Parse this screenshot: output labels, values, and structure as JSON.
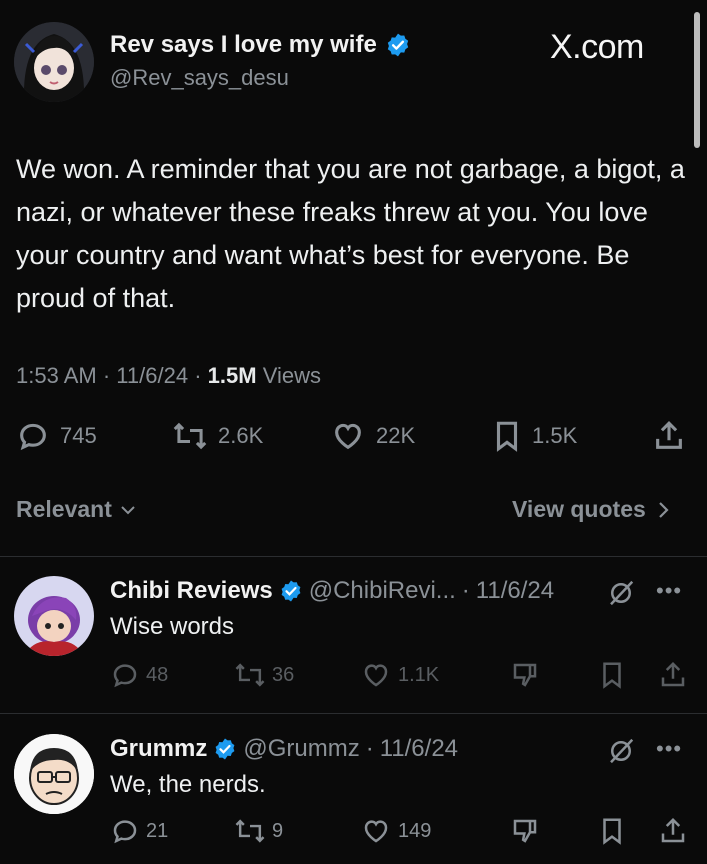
{
  "main_tweet": {
    "author_name": "Rev says I love my wife",
    "handle": "@Rev_says_desu",
    "site": "X.com",
    "text": "We won. A reminder that you are not garbage, a bigot, a nazi, or whatever these freaks threw at you. You love your country and want what’s best for everyone. Be proud of that.",
    "time": "1:53 AM",
    "date": "11/6/24",
    "views_count": "1.5M",
    "views_label": "Views",
    "sep": "·",
    "replies": "745",
    "reposts": "2.6K",
    "likes": "22K",
    "bookmarks": "1.5K"
  },
  "sort": {
    "label": "Relevant",
    "view_quotes": "View quotes"
  },
  "replies": [
    {
      "name": "Chibi Reviews",
      "handle": "@ChibiRevi...",
      "date": "11/6/24",
      "text": "Wise words",
      "replies": "48",
      "reposts": "36",
      "likes": "1.1K"
    },
    {
      "name": "Grummz",
      "handle": "@Grummz",
      "date": "11/6/24",
      "text": "We, the nerds.",
      "replies": "21",
      "reposts": "9",
      "likes": "149"
    }
  ],
  "colors": {
    "background": "#0a0a0a",
    "verified": "#1d9bf0",
    "muted": "#8b9197",
    "text": "#e7e9ea"
  }
}
